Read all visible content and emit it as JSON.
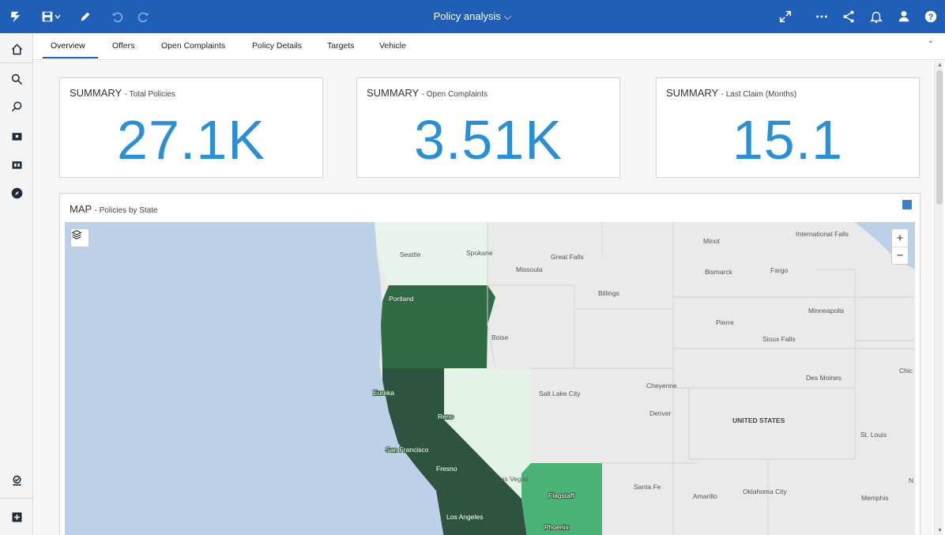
{
  "header": {
    "title": "Policy analysis",
    "icons": [
      "app-logo-icon",
      "save-icon",
      "pencil-icon",
      "undo-icon",
      "redo-icon",
      "fullscreen-icon",
      "more-icon",
      "share-icon",
      "bell-icon",
      "user-icon",
      "help-icon"
    ]
  },
  "tabs": [
    {
      "label": "Overview",
      "active": true
    },
    {
      "label": "Offers"
    },
    {
      "label": "Open Complaints"
    },
    {
      "label": "Policy Details"
    },
    {
      "label": "Targets"
    },
    {
      "label": "Vehicle"
    }
  ],
  "summaries": [
    {
      "title": "SUMMARY",
      "subtitle": "- Total Policies",
      "value": "27.1K"
    },
    {
      "title": "SUMMARY",
      "subtitle": "- Open Complaints",
      "value": "3.51K"
    },
    {
      "title": "SUMMARY",
      "subtitle": "- Last Claim (Months)",
      "value": "15.1"
    }
  ],
  "map": {
    "title": "MAP",
    "subtitle": "- Policies by State",
    "zoom_in": "+",
    "zoom_out": "−",
    "state_colors": {
      "washington": "#e8f5ec",
      "oregon": "#2f6b45",
      "california": "#2e5340",
      "nevada": "#e4f3e8",
      "arizona": "#4cb377",
      "idaho": "#e7e7e7",
      "utah": "#e7e7e7"
    },
    "ocean_color": "#bcd1e7",
    "labels": {
      "seattle": "Seattle",
      "spokane": "Spokane",
      "great_falls": "Great Falls",
      "missoula": "Missoula",
      "minot": "Minot",
      "international_falls": "International Falls",
      "bismarck": "Bismarck",
      "fargo": "Fargo",
      "portland": "Portland",
      "billings": "Billings",
      "minneapolis": "Minneapolis",
      "pierre": "Pierre",
      "boise": "Boise",
      "sioux_falls": "Sioux Falls",
      "chicago": "Chic",
      "des_moines": "Des Moines",
      "eureka": "Eureka",
      "salt_lake_city": "Salt Lake City",
      "cheyenne": "Cheyenne",
      "reno": "Reno",
      "denver": "Denver",
      "united_states": "UNITED STATES",
      "st_louis": "St. Louis",
      "san_francisco": "San Francisco",
      "fresno": "Fresno",
      "las_vegas": "Las Vegas",
      "santa_fe": "Santa Fe",
      "flagstaff": "Flagstaff",
      "amarillo": "Amarillo",
      "oklahoma_city": "Oklahoma City",
      "memphis": "Memphis",
      "nashville_cut": "N",
      "los_angeles": "Los Angeles",
      "phoenix": "Phoenix"
    }
  }
}
